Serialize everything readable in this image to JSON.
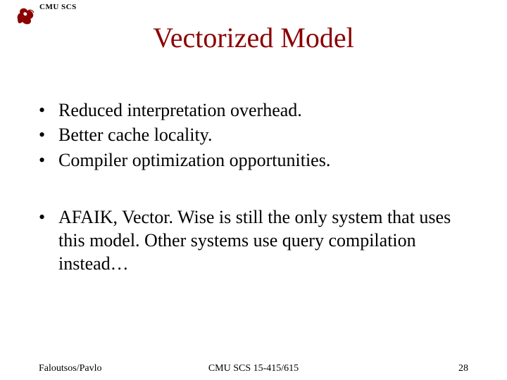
{
  "header": {
    "org": "CMU SCS"
  },
  "title": "Vectorized Model",
  "bullets_group1": [
    "Reduced interpretation overhead.",
    "Better cache locality.",
    "Compiler optimization opportunities."
  ],
  "bullets_group2": [
    "AFAIK, Vector. Wise is still the only system that uses this model. Other systems use query compilation instead…"
  ],
  "footer": {
    "left": "Faloutsos/Pavlo",
    "center": "CMU SCS 15-415/615",
    "right": "28"
  },
  "colors": {
    "title": "#8B0000",
    "logo": "#8B0000"
  }
}
